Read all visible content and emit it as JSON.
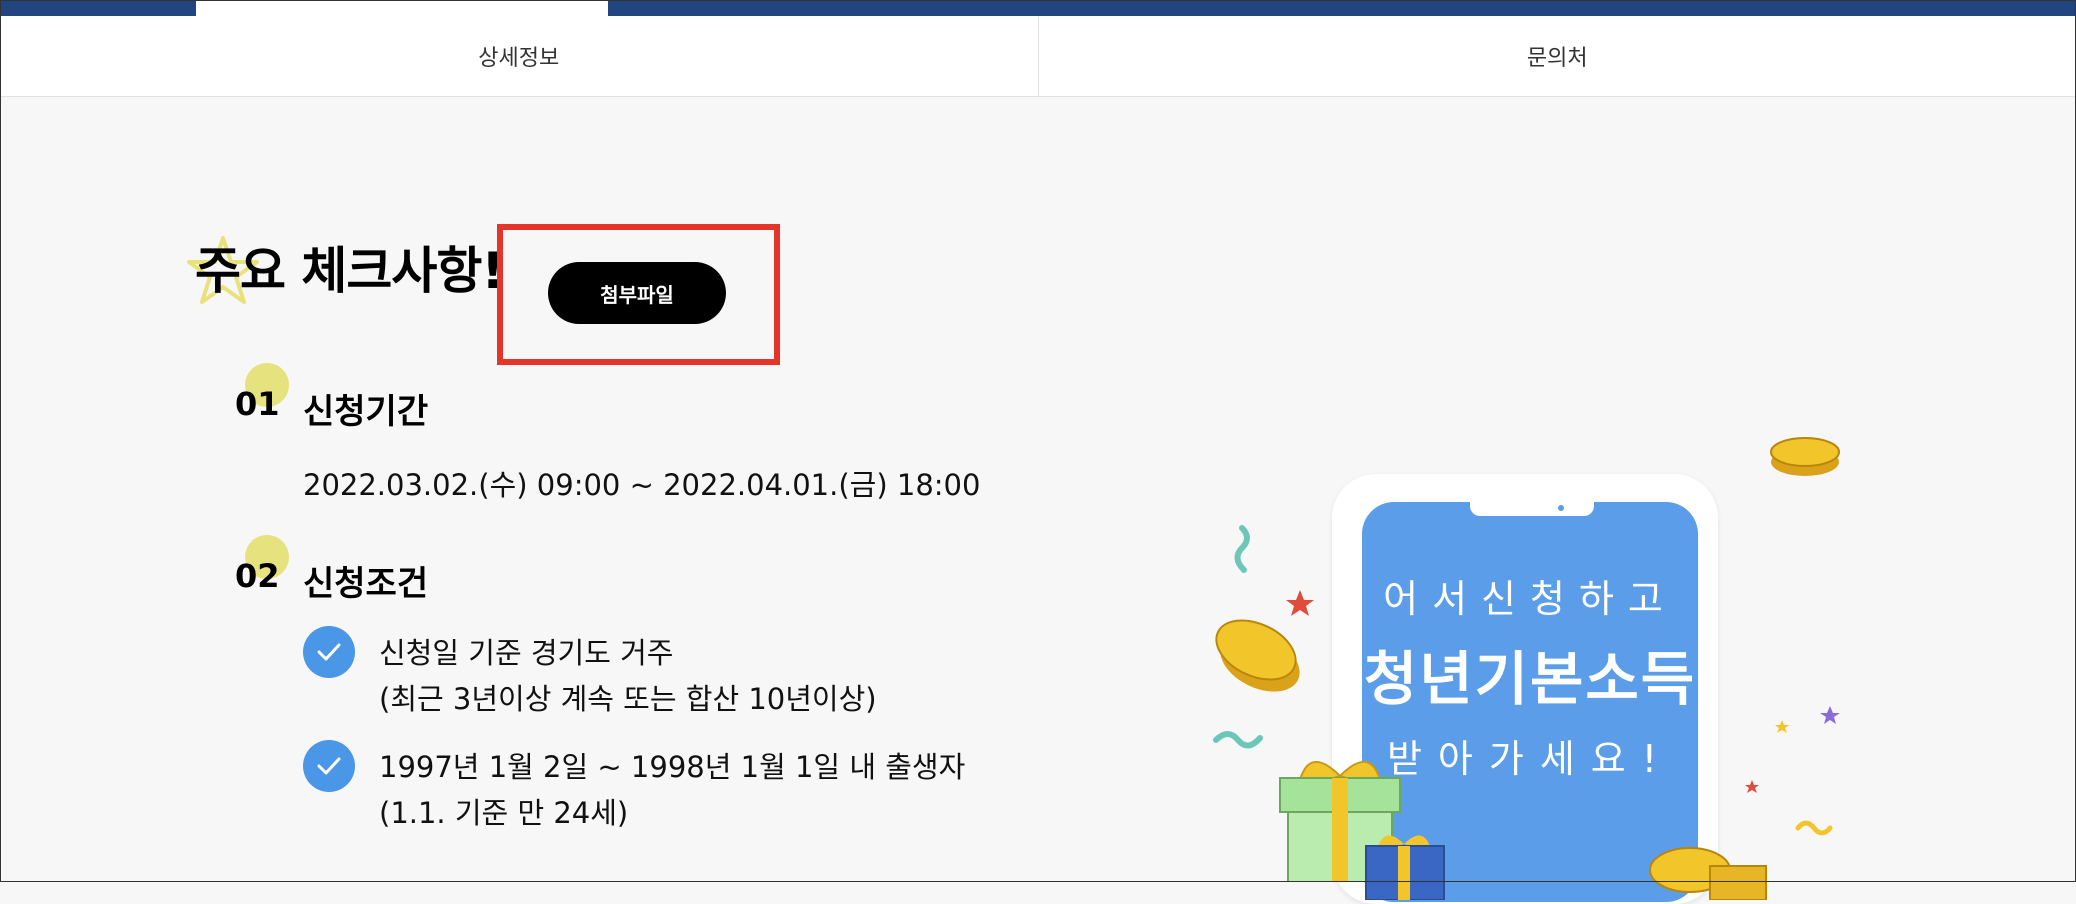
{
  "tabs": [
    {
      "label": "상세정보"
    },
    {
      "label": "문의처"
    }
  ],
  "heading": {
    "title": "주요 체크사항!",
    "attach_button": "첨부파일"
  },
  "sections": [
    {
      "number": "01",
      "title": "신청기간",
      "period": "2022.03.02.(수) 09:00 ~ 2022.04.01.(금) 18:00"
    },
    {
      "number": "02",
      "title": "신청조건"
    }
  ],
  "conditions": [
    {
      "line1": "신청일 기준 경기도 거주",
      "line2": "(최근 3년이상 계속 또는 합산 10년이상)"
    },
    {
      "line1": "1997년 1월 2일 ~ 1998년 1월 1일 내 출생자",
      "line2": "(1.1. 기준 만 24세)"
    }
  ],
  "banner": {
    "line1": "어서신청하고",
    "line2": "청년기본소득",
    "line3": "받아가세요!"
  },
  "colors": {
    "top_bar": "#21467f",
    "check_circle": "#4a97e8",
    "number_circle": "#e6e27d",
    "phone_screen": "#5b9de8",
    "highlight_box": "#e4352a"
  },
  "icons": [
    "star-icon",
    "check-icon",
    "coin-icon",
    "gift-box-icon",
    "confetti-icon"
  ]
}
